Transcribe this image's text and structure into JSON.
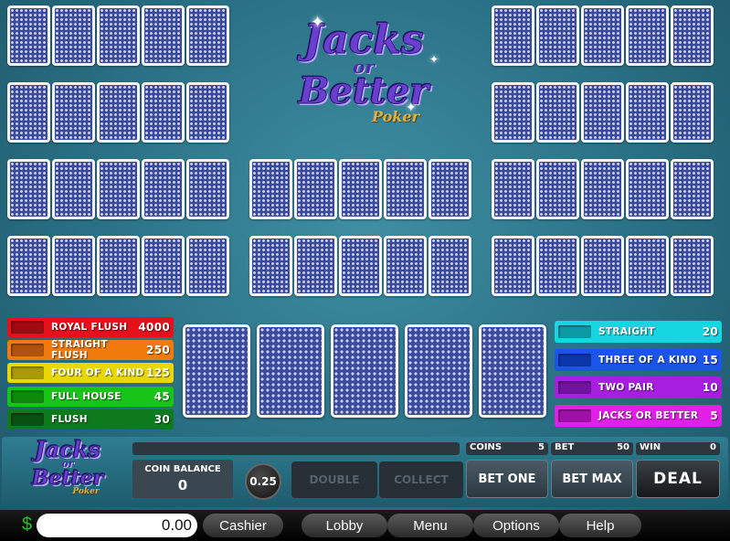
{
  "logo": {
    "line1": "Jacks",
    "line2": "or",
    "line3": "Better",
    "line4": "Poker"
  },
  "paytable_left": [
    {
      "name": "ROYAL FLUSH",
      "value": "4000",
      "color": "#e5101c",
      "swatch": "#a40810"
    },
    {
      "name": "STRAIGHT FLUSH",
      "value": "250",
      "color": "#f07a0c",
      "swatch": "#b0520a"
    },
    {
      "name": "FOUR OF A KIND",
      "value": "125",
      "color": "#e8d800",
      "swatch": "#a89a00"
    },
    {
      "name": "FULL HOUSE",
      "value": "45",
      "color": "#18c418",
      "swatch": "#0c8a0c"
    },
    {
      "name": "FLUSH",
      "value": "30",
      "color": "#0e7a1e",
      "swatch": "#075212"
    }
  ],
  "paytable_right": [
    {
      "name": "STRAIGHT",
      "value": "20",
      "color": "#16d6e2",
      "swatch": "#0c9aa4"
    },
    {
      "name": "THREE OF A KIND",
      "value": "15",
      "color": "#1a54e8",
      "swatch": "#0c36a8"
    },
    {
      "name": "TWO PAIR",
      "value": "10",
      "color": "#a81ee0",
      "swatch": "#7212a0"
    },
    {
      "name": "JACKS OR BETTER",
      "value": "5",
      "color": "#e020e6",
      "swatch": "#a010a8"
    }
  ],
  "panel": {
    "coin_balance_label": "COIN BALANCE",
    "coin_balance_value": "0",
    "coin_value": "0.25",
    "double_label": "DOUBLE",
    "collect_label": "COLLECT",
    "coins_label": "COINS",
    "coins_value": "5",
    "bet_label": "BET",
    "bet_value": "50",
    "win_label": "WIN",
    "win_value": "0",
    "bet_one_label": "BET ONE",
    "bet_max_label": "BET MAX",
    "deal_label": "DEAL"
  },
  "footer": {
    "currency_symbol": "$",
    "balance": "0.00",
    "cashier": "Cashier",
    "lobby": "Lobby",
    "menu": "Menu",
    "options": "Options",
    "help": "Help"
  },
  "colors": {
    "table_bg": "#2a6f84",
    "currency_green": "#1ec41e"
  },
  "hand_count_small": 10,
  "cards_per_hand": 5
}
